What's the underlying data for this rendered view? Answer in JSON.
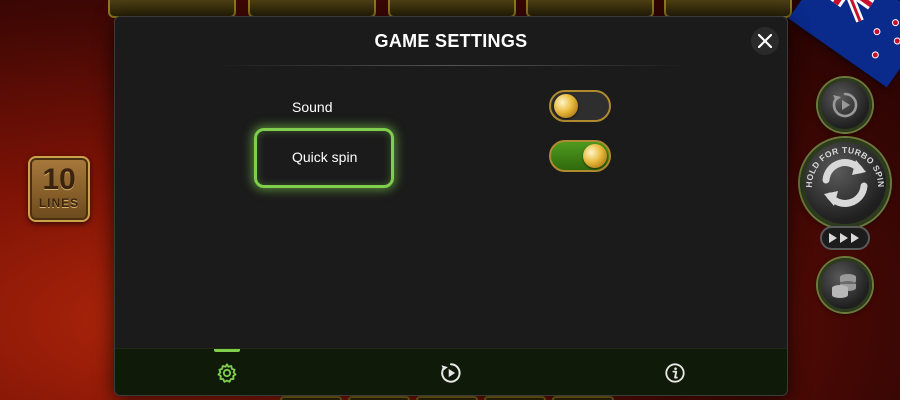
{
  "modal": {
    "title": "GAME SETTINGS",
    "settings": [
      {
        "label": "Sound",
        "enabled": false
      },
      {
        "label": "Quick spin",
        "enabled": true
      }
    ],
    "tabs": [
      {
        "icon": "gear-icon",
        "active": true
      },
      {
        "icon": "autoplay-icon",
        "active": false
      },
      {
        "icon": "info-icon",
        "active": false
      }
    ]
  },
  "game": {
    "lines_count": "10",
    "lines_label": "LINES",
    "spin_hint": "HOLD FOR TURBO SPIN"
  },
  "colors": {
    "accent_green": "#7fcf4c",
    "toggle_on": "#4f9a1f",
    "toggle_border": "#b08a2e",
    "modal_bg": "#1b1b1b"
  }
}
